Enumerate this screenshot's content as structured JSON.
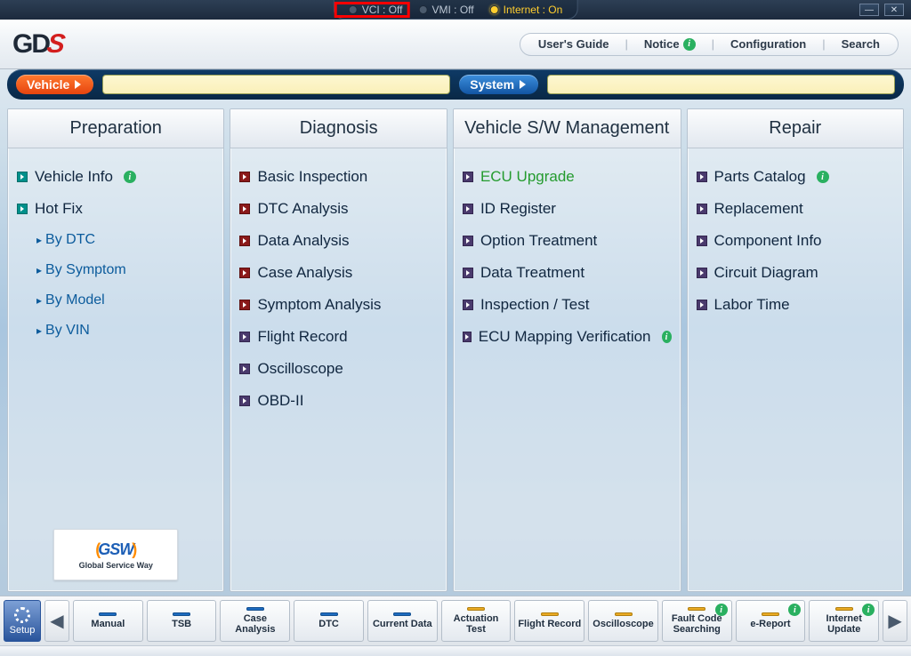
{
  "status": {
    "vci": {
      "label": "VCI : Off",
      "on": false,
      "highlighted": true
    },
    "vmi": {
      "label": "VMI : Off",
      "on": false
    },
    "internet": {
      "label": "Internet : On",
      "on": true
    }
  },
  "logo": "GD",
  "nav": {
    "user_guide": "User's Guide",
    "notice": "Notice",
    "config": "Configuration",
    "search": "Search"
  },
  "band": {
    "vehicle": "Vehicle",
    "system": "System"
  },
  "panels": {
    "preparation": {
      "title": "Preparation",
      "items": [
        {
          "label": "Vehicle Info",
          "style": "teal",
          "info": true
        },
        {
          "label": "Hot Fix",
          "style": "teal"
        }
      ],
      "subs": [
        "By DTC",
        "By Symptom",
        "By Model",
        "By VIN"
      ],
      "gsw": {
        "logo": "GSW",
        "sub": "Global Service Way"
      }
    },
    "diagnosis": {
      "title": "Diagnosis",
      "items": [
        {
          "label": "Basic Inspection",
          "style": "red"
        },
        {
          "label": "DTC Analysis",
          "style": "red"
        },
        {
          "label": "Data Analysis",
          "style": "red"
        },
        {
          "label": "Case Analysis",
          "style": "red"
        },
        {
          "label": "Symptom Analysis",
          "style": "red"
        },
        {
          "label": "Flight Record",
          "style": "purple"
        },
        {
          "label": "Oscilloscope",
          "style": "purple"
        },
        {
          "label": "OBD-II",
          "style": "purple"
        }
      ]
    },
    "vehicle_sw": {
      "title": "Vehicle S/W Management",
      "items": [
        {
          "label": "ECU Upgrade",
          "style": "purple",
          "green": true
        },
        {
          "label": "ID Register",
          "style": "purple"
        },
        {
          "label": "Option Treatment",
          "style": "purple"
        },
        {
          "label": "Data Treatment",
          "style": "purple"
        },
        {
          "label": "Inspection / Test",
          "style": "purple"
        },
        {
          "label": "ECU Mapping Verification",
          "style": "purple",
          "info": true
        }
      ]
    },
    "repair": {
      "title": "Repair",
      "items": [
        {
          "label": "Parts Catalog",
          "style": "purple",
          "info": true
        },
        {
          "label": "Replacement",
          "style": "purple"
        },
        {
          "label": "Component Info",
          "style": "purple"
        },
        {
          "label": "Circuit Diagram",
          "style": "purple"
        },
        {
          "label": "Labor Time",
          "style": "purple"
        }
      ]
    }
  },
  "setup_label": "Setup",
  "toolbar": [
    {
      "label": "Manual",
      "chip": "blue"
    },
    {
      "label": "TSB",
      "chip": "blue"
    },
    {
      "label": "Case Analysis",
      "chip": "blue"
    },
    {
      "label": "DTC",
      "chip": "blue"
    },
    {
      "label": "Current Data",
      "chip": "blue"
    },
    {
      "label": "Actuation Test",
      "chip": "amber"
    },
    {
      "label": "Flight Record",
      "chip": "amber"
    },
    {
      "label": "Oscilloscope",
      "chip": "amber"
    },
    {
      "label": "Fault Code Searching",
      "chip": "amber",
      "info": true
    },
    {
      "label": "e-Report",
      "chip": "amber",
      "info": true
    },
    {
      "label": "Internet Update",
      "chip": "amber",
      "info": true
    }
  ]
}
